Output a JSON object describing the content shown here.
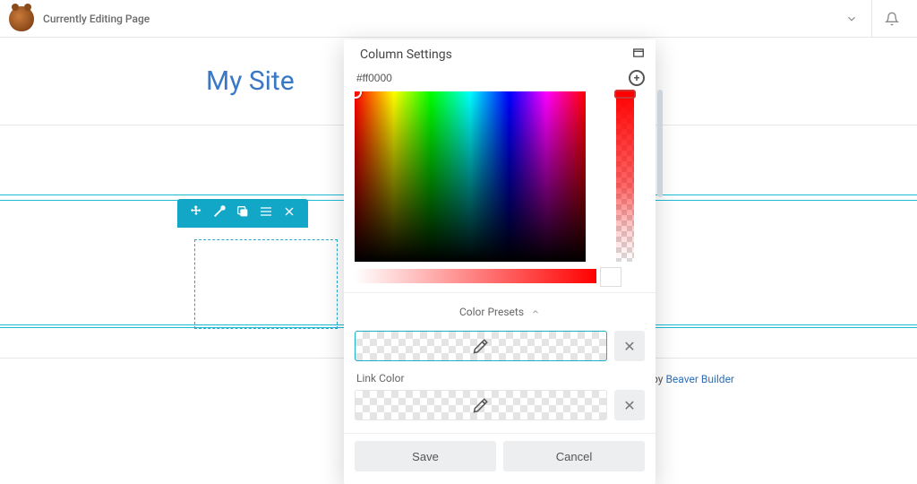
{
  "topbar": {
    "editing_label": "Currently Editing Page"
  },
  "site": {
    "title": "My Site"
  },
  "footer": {
    "prefix": "by ",
    "link_text": "Beaver Builder"
  },
  "panel": {
    "title": "Column Settings",
    "color_hex": "#ff0000",
    "presets_label": "Color Presets",
    "link_color_label": "Link Color",
    "save_label": "Save",
    "cancel_label": "Cancel"
  }
}
